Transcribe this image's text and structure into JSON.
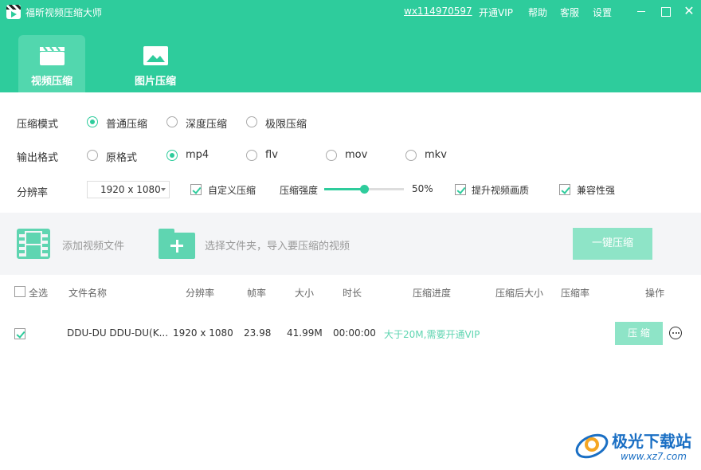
{
  "app": {
    "title": "福昕视频压缩大师",
    "account": "wx114970597",
    "vip": "开通VIP",
    "help": "帮助",
    "service": "客服",
    "settings": "设置"
  },
  "tabs": [
    {
      "label": "视频压缩",
      "active": true,
      "icon": "clapperboard-icon"
    },
    {
      "label": "图片压缩",
      "active": false,
      "icon": "image-icon"
    }
  ],
  "settings": {
    "mode": {
      "label": "压缩模式",
      "options": [
        "普通压缩",
        "深度压缩",
        "极限压缩"
      ],
      "selected": "普通压缩"
    },
    "format": {
      "label": "输出格式",
      "options": [
        "原格式",
        "mp4",
        "flv",
        "mov",
        "mkv"
      ],
      "selected": "mp4"
    },
    "resolution": {
      "label": "分辨率",
      "value": "1920 x 1080"
    },
    "custom_compress": {
      "label": "自定义压缩",
      "checked": true
    },
    "strength": {
      "label": "压缩强度",
      "value_text": "50%",
      "value": 0.5
    },
    "enhance_quality": {
      "label": "提升视频画质",
      "checked": true
    },
    "compatibility": {
      "label": "兼容性强",
      "checked": true
    }
  },
  "add": {
    "add_file": "添加视频文件",
    "add_folder": "选择文件夹，导入要压缩的视频",
    "one_key": "一键压缩"
  },
  "table": {
    "select_all": "全选",
    "headers": [
      "文件名称",
      "分辨率",
      "帧率",
      "大小",
      "时长",
      "压缩进度",
      "压缩后大小",
      "压缩率",
      "操作"
    ],
    "rows": [
      {
        "checked": true,
        "name": "DDU-DU DDU-DU(K...",
        "resolution": "1920 x 1080",
        "fps": "23.98",
        "size": "41.99M",
        "duration": "00:00:00",
        "progress": "大于20M,需要开通VIP",
        "action": "压 缩"
      }
    ]
  },
  "watermark": {
    "name": "极光下载站",
    "url": "www.xz7.com"
  },
  "colors": {
    "brand": "#2ecc9c",
    "brand_light": "#8ee4c7"
  }
}
